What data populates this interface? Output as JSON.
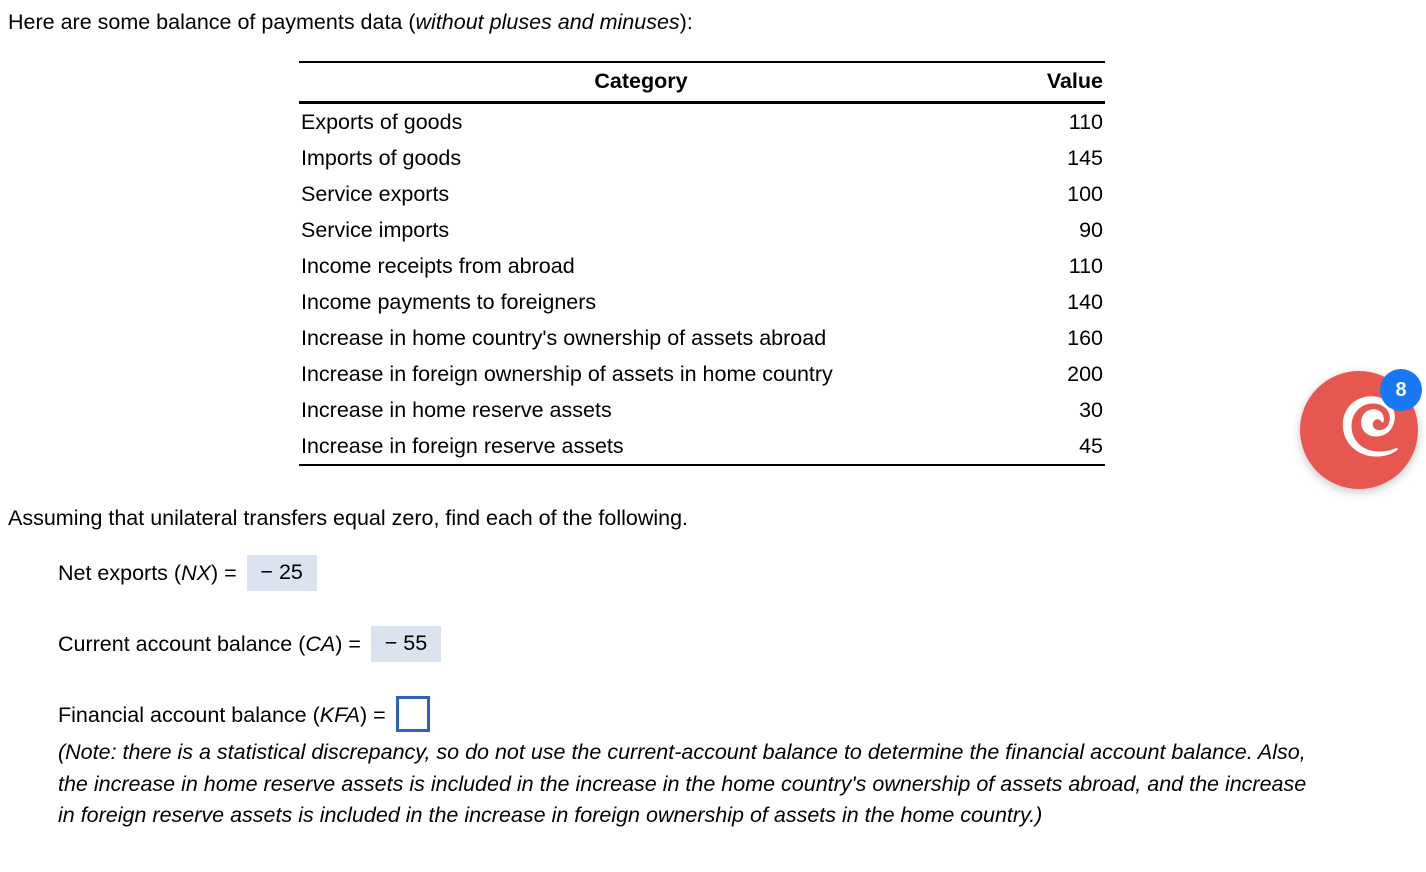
{
  "intro": {
    "text_before": "Here are some balance of payments data (",
    "emphasis": "without pluses and minuses",
    "text_after": "):"
  },
  "table": {
    "headers": {
      "category": "Category",
      "value": "Value"
    },
    "rows": [
      {
        "category": "Exports of goods",
        "value": "110"
      },
      {
        "category": "Imports of goods",
        "value": "145"
      },
      {
        "category": "Service exports",
        "value": "100"
      },
      {
        "category": "Service imports",
        "value": "90"
      },
      {
        "category": "Income receipts from abroad",
        "value": "110"
      },
      {
        "category": "Income payments to foreigners",
        "value": "140"
      },
      {
        "category": "Increase in home country's ownership of assets abroad",
        "value": "160"
      },
      {
        "category": "Increase in foreign ownership of assets in home country",
        "value": "200"
      },
      {
        "category": "Increase in home reserve assets",
        "value": "30"
      },
      {
        "category": "Increase in foreign reserve assets",
        "value": "45"
      }
    ]
  },
  "prompt": {
    "instruction": "Assuming that unilateral transfers equal zero, find each of the following."
  },
  "answers": {
    "net_exports": {
      "label_before": "Net exports (",
      "symbol": "NX",
      "label_after": ") =",
      "value": "− 25",
      "state": "filled"
    },
    "current_account": {
      "label_before": "Current account balance (",
      "symbol": "CA",
      "label_after": ") =",
      "value": "− 55",
      "state": "filled"
    },
    "financial_account": {
      "label_before": "Financial account balance (",
      "symbol": "KFA",
      "label_after": ") =",
      "value": "",
      "state": "empty",
      "placeholder": ""
    }
  },
  "note": {
    "text": "(Note: there is a statistical discrepancy, so do not use the current-account balance to determine the financial account balance. Also, the increase in home reserve assets is included in the increase in the home country's ownership of assets abroad, and the increase in foreign reserve assets is included in the increase in foreign ownership of assets in the home country.)"
  },
  "chat_widget": {
    "badge_count": "8",
    "bubble_color": "#e8574f",
    "badge_color": "#1877f2",
    "logo_name": "swirl-e-logo"
  },
  "colors": {
    "answer_fill_background": "#dbe3f0",
    "empty_input_border": "#2f62bf",
    "text": "#000000"
  }
}
